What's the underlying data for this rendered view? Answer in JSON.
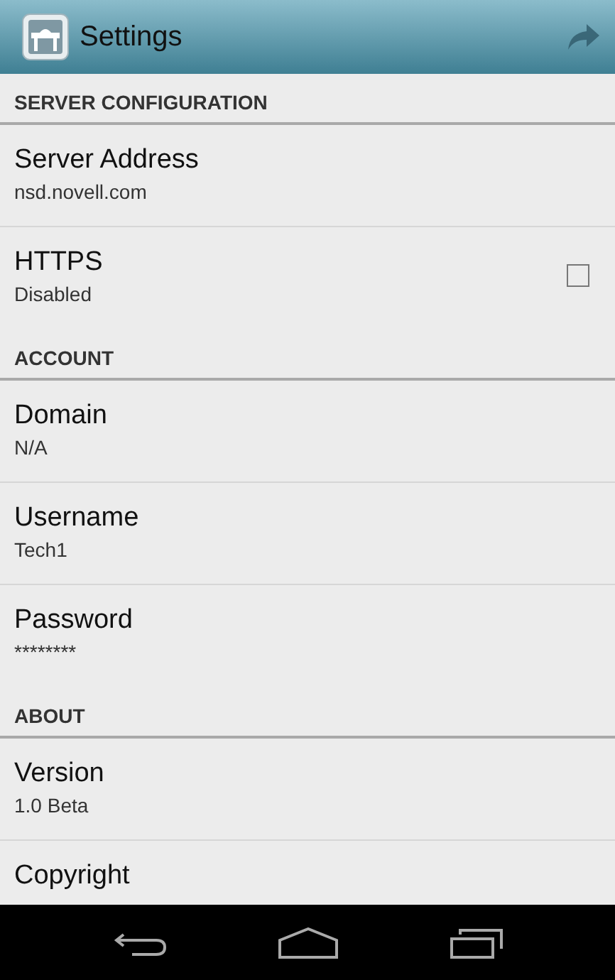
{
  "action_bar": {
    "title": "Settings"
  },
  "sections": [
    {
      "title": "SERVER CONFIGURATION",
      "items": [
        {
          "kind": "text",
          "title": "Server Address",
          "summary": "nsd.novell.com"
        },
        {
          "kind": "checkbox",
          "title": "HTTPS",
          "summary": "Disabled",
          "checked": false
        }
      ]
    },
    {
      "title": "ACCOUNT",
      "items": [
        {
          "kind": "text",
          "title": "Domain",
          "summary": "N/A"
        },
        {
          "kind": "text",
          "title": "Username",
          "summary": "Tech1"
        },
        {
          "kind": "text",
          "title": "Password",
          "summary": "********"
        }
      ]
    },
    {
      "title": "ABOUT",
      "items": [
        {
          "kind": "text",
          "title": "Version",
          "summary": "1.0 Beta"
        },
        {
          "kind": "text",
          "title": "Copyright"
        }
      ]
    }
  ]
}
